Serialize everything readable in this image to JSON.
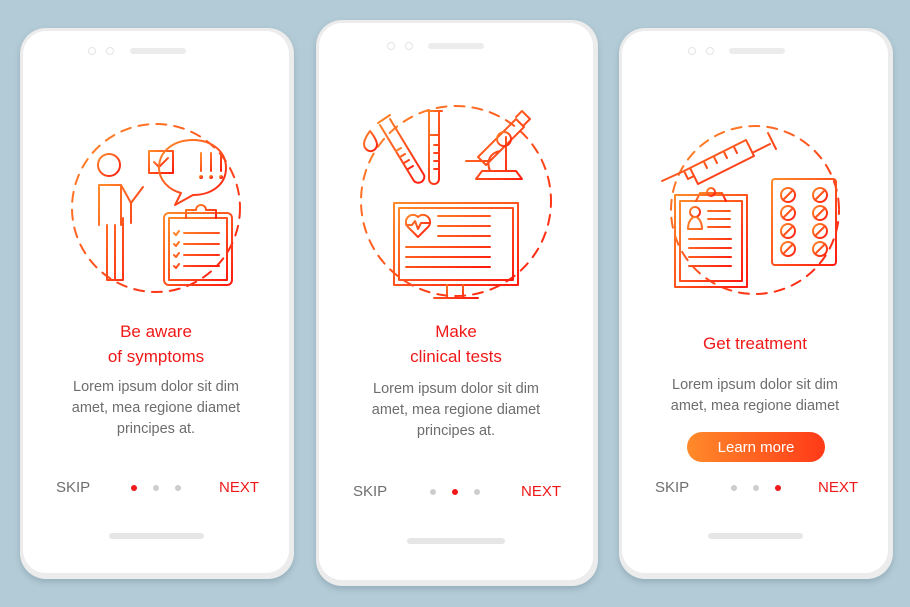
{
  "colors": {
    "background": "#b3cbd6",
    "accent": "#f01818",
    "gradient_start": "#ff8a2a",
    "gradient_end": "#ff2a10",
    "body_text": "#6d6d6d",
    "inactive_dot": "#cdcdcd"
  },
  "screens": [
    {
      "illustration": "symptoms-illustration",
      "icons": [
        "person-icon",
        "checkbox-icon",
        "exclamation-speech-bubble-icon",
        "checklist-clipboard-icon"
      ],
      "title_line1": "Be aware",
      "title_line2": "of symptoms",
      "desc_line1": "Lorem ipsum dolor sit dim",
      "desc_line2": "amet, mea regione diamet",
      "desc_line3": "principes at.",
      "skip_label": "SKIP",
      "next_label": "NEXT",
      "active_page": 1,
      "total_pages": 3
    },
    {
      "illustration": "clinical-tests-illustration",
      "icons": [
        "test-tube-drop-icon",
        "test-tube-icon",
        "microscope-icon",
        "monitor-heartbeat-icon"
      ],
      "title_line1": "Make",
      "title_line2": "clinical tests",
      "desc_line1": "Lorem ipsum dolor sit dim",
      "desc_line2": "amet, mea regione diamet",
      "desc_line3": "principes at.",
      "skip_label": "SKIP",
      "next_label": "NEXT",
      "active_page": 2,
      "total_pages": 3
    },
    {
      "illustration": "treatment-illustration",
      "icons": [
        "syringe-icon",
        "medical-record-clipboard-icon",
        "pill-blister-icon"
      ],
      "title_line1": "Get treatment",
      "desc_line1": "Lorem ipsum dolor sit dim",
      "desc_line2": "amet, mea regione diamet",
      "button_label": "Learn more",
      "skip_label": "SKIP",
      "next_label": "NEXT",
      "active_page": 3,
      "total_pages": 3
    }
  ]
}
